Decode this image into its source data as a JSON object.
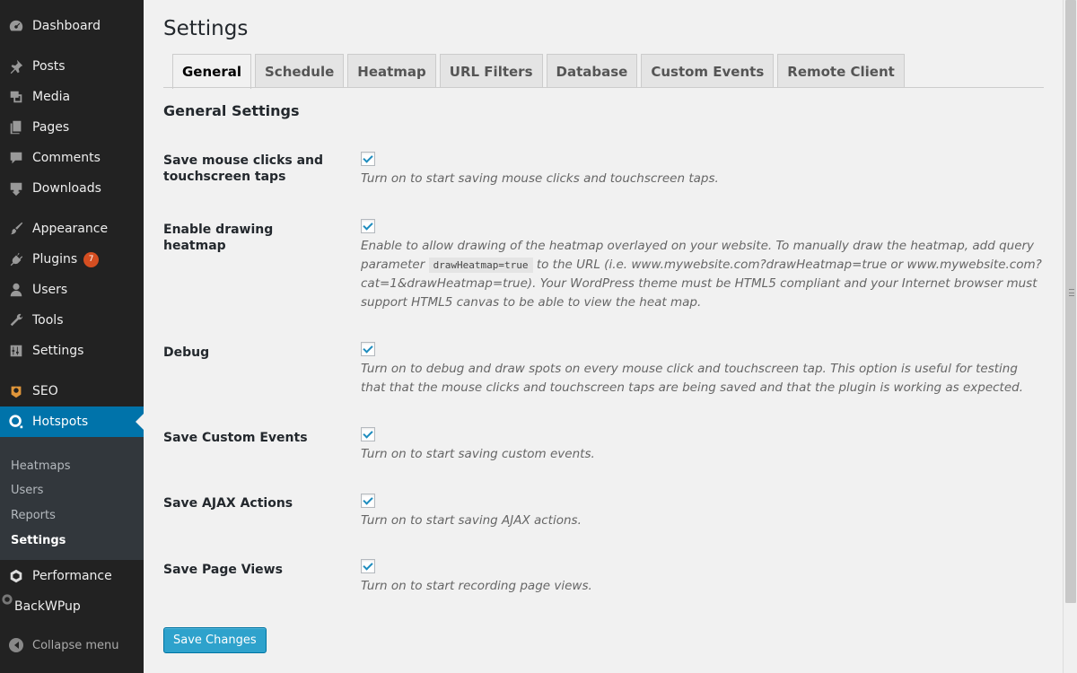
{
  "sidebar": {
    "items": [
      {
        "label": "Dashboard",
        "icon": "dashboard-icon"
      },
      {
        "label": "Posts",
        "icon": "pin-icon"
      },
      {
        "label": "Media",
        "icon": "media-icon"
      },
      {
        "label": "Pages",
        "icon": "pages-icon"
      },
      {
        "label": "Comments",
        "icon": "comment-icon"
      },
      {
        "label": "Downloads",
        "icon": "download-icon"
      },
      {
        "label": "Appearance",
        "icon": "brush-icon"
      },
      {
        "label": "Plugins",
        "icon": "plugin-icon",
        "badge": "7"
      },
      {
        "label": "Users",
        "icon": "user-icon"
      },
      {
        "label": "Tools",
        "icon": "wrench-icon"
      },
      {
        "label": "Settings",
        "icon": "settings-icon"
      },
      {
        "label": "SEO",
        "icon": "seo-icon"
      },
      {
        "label": "Hotspots",
        "icon": "hotspots-icon",
        "active": true
      },
      {
        "label": "Performance",
        "icon": "performance-icon"
      },
      {
        "label": "BackWPup",
        "icon": "backwpup-icon"
      }
    ],
    "submenu": [
      {
        "label": "Heatmaps"
      },
      {
        "label": "Users"
      },
      {
        "label": "Reports"
      },
      {
        "label": "Settings",
        "current": true
      }
    ],
    "collapse_label": "Collapse menu"
  },
  "main": {
    "title": "Settings",
    "tabs": [
      "General",
      "Schedule",
      "Heatmap",
      "URL Filters",
      "Database",
      "Custom Events",
      "Remote Client"
    ],
    "active_tab": "General",
    "section_title": "General Settings",
    "settings": [
      {
        "label": "Save mouse clicks and touchscreen taps",
        "checked": true,
        "desc": "Turn on to start saving mouse clicks and touchscreen taps."
      },
      {
        "label": "Enable drawing heatmap",
        "checked": true,
        "desc_pre": "Enable to allow drawing of the heatmap overlayed on your website. To manually draw the heatmap, add query parameter ",
        "desc_code": "drawHeatmap=true",
        "desc_post": " to the URL (i.e. www.mywebsite.com?drawHeatmap=true or www.mywebsite.com?cat=1&drawHeatmap=true). Your WordPress theme must be HTML5 compliant and your Internet browser must support HTML5 canvas to be able to view the heat map."
      },
      {
        "label": "Debug",
        "checked": true,
        "desc": "Turn on to debug and draw spots on every mouse click and touchscreen tap. This option is useful for testing that that the mouse clicks and touchscreen taps are being saved and that the plugin is working as expected."
      },
      {
        "label": "Save Custom Events",
        "checked": true,
        "desc": "Turn on to start saving custom events."
      },
      {
        "label": "Save AJAX Actions",
        "checked": true,
        "desc": "Turn on to start saving AJAX actions."
      },
      {
        "label": "Save Page Views",
        "checked": true,
        "desc": "Turn on to start recording page views."
      }
    ],
    "save_label": "Save Changes"
  },
  "colors": {
    "sidebar_bg": "#222222",
    "active_bg": "#0073aa",
    "submenu_bg": "#32373c",
    "badge": "#d54e21",
    "button": "#2ea2cc"
  }
}
